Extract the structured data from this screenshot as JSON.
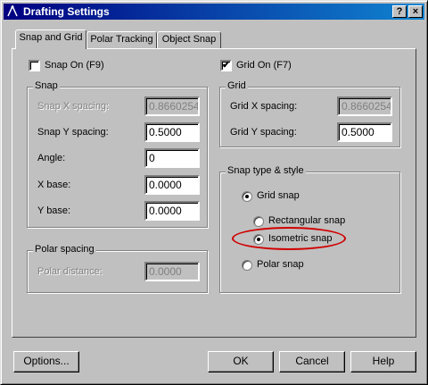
{
  "window": {
    "title": "Drafting Settings",
    "help_btn": "?",
    "close_btn": "×"
  },
  "tabs": [
    {
      "label": "Snap and Grid",
      "active": true
    },
    {
      "label": "Polar Tracking",
      "active": false
    },
    {
      "label": "Object Snap",
      "active": false
    }
  ],
  "snap_on": {
    "label": "Snap On (F9)",
    "checked": false
  },
  "grid_on": {
    "label": "Grid On (F7)",
    "checked": true,
    "mark": "✔"
  },
  "snap_group": {
    "title": "Snap",
    "x_spacing_label": "Snap X spacing:",
    "x_spacing_value": "0.86602540",
    "y_spacing_label": "Snap Y spacing:",
    "y_spacing_value": "0.5000",
    "angle_label": "Angle:",
    "angle_value": "0",
    "xbase_label": "X base:",
    "xbase_value": "0.0000",
    "ybase_label": "Y base:",
    "ybase_value": "0.0000"
  },
  "grid_group": {
    "title": "Grid",
    "x_spacing_label": "Grid X spacing:",
    "x_spacing_value": "0.86602540",
    "y_spacing_label": "Grid Y spacing:",
    "y_spacing_value": "0.5000"
  },
  "polar_group": {
    "title": "Polar spacing",
    "distance_label": "Polar distance:",
    "distance_value": "0.0000"
  },
  "snap_type_group": {
    "title": "Snap type & style",
    "grid_snap": "Grid snap",
    "rectangular_snap": "Rectangular snap",
    "isometric_snap": "Isometric snap",
    "polar_snap": "Polar snap",
    "selected_type": "grid_snap",
    "selected_style": "isometric_snap"
  },
  "buttons": {
    "options": "Options...",
    "ok": "OK",
    "cancel": "Cancel",
    "help": "Help"
  },
  "colors": {
    "titlebar": "#000080",
    "highlight": "#d00000",
    "face": "#c0c0c0"
  }
}
